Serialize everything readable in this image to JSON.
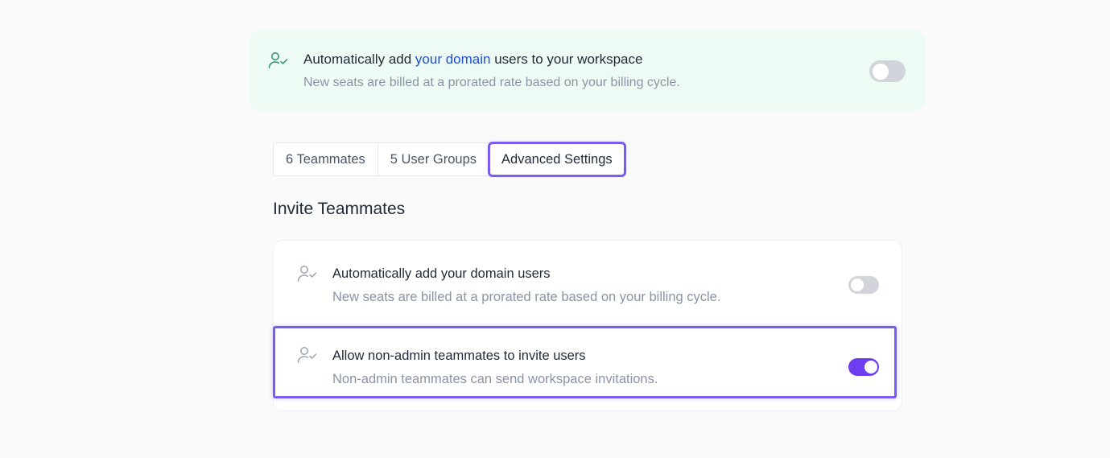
{
  "banner": {
    "title_before": "Automatically add ",
    "title_link": "your domain",
    "title_after": " users to your workspace",
    "description": "New seats are billed at a prorated rate based on your billing cycle.",
    "icon": "user-check-icon",
    "toggle_on": false
  },
  "tabs": [
    {
      "label": "6 Teammates",
      "active": false
    },
    {
      "label": "5 User Groups",
      "active": false
    },
    {
      "label": "Advanced Settings",
      "active": true
    }
  ],
  "section": {
    "title": "Invite Teammates"
  },
  "settings": [
    {
      "title": "Automatically add your domain users",
      "description": "New seats are billed at a prorated rate based on your billing cycle.",
      "icon": "user-check-icon",
      "toggle_on": false
    },
    {
      "title": "Allow non-admin teammates to invite users",
      "description": "Non-admin teammates can send workspace invitations.",
      "icon": "user-check-icon",
      "toggle_on": true
    }
  ],
  "colors": {
    "accent": "#6d3df0",
    "highlight": "#7c5cf0",
    "banner_bg": "#edfbf4",
    "link": "#1d4ed8"
  }
}
